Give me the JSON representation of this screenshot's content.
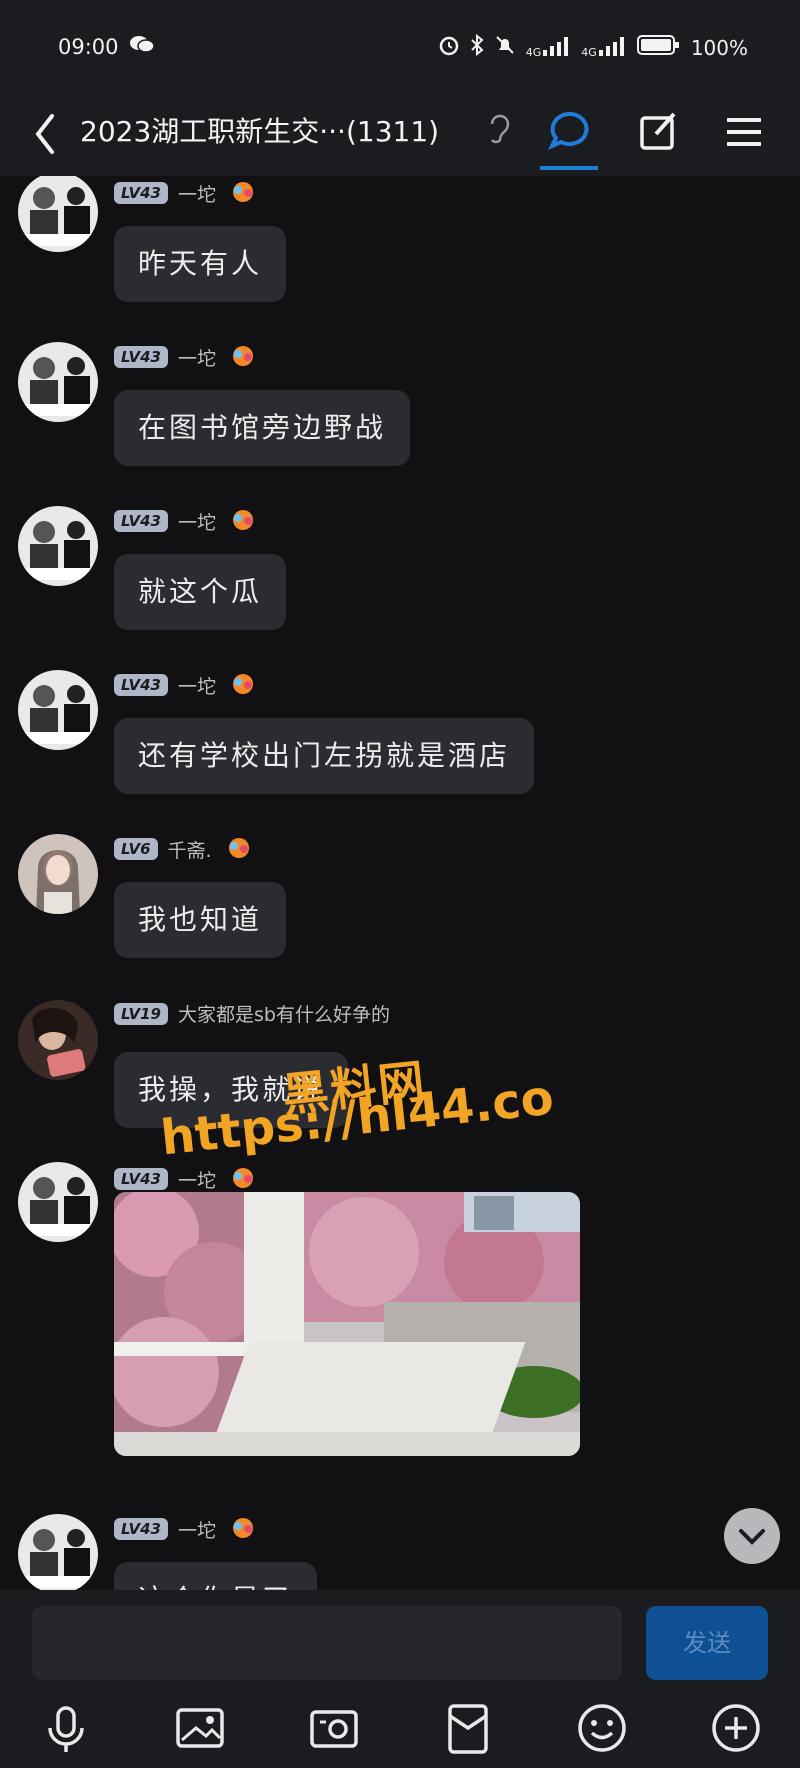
{
  "status": {
    "time": "09:00",
    "battery": "100%",
    "net1": "4G",
    "net2": "4G"
  },
  "header": {
    "title": "2023湖工职新生交···(1311)"
  },
  "messages": [
    {
      "level": "LV43",
      "name": "一坨",
      "text": "昨天有人"
    },
    {
      "level": "LV43",
      "name": "一坨",
      "text": "在图书馆旁边野战"
    },
    {
      "level": "LV43",
      "name": "一坨",
      "text": "就这个瓜"
    },
    {
      "level": "LV43",
      "name": "一坨",
      "text": "还有学校出门左拐就是酒店"
    },
    {
      "level": "LV6",
      "name": "千斋.",
      "text": "我也知道"
    },
    {
      "level": "LV19",
      "name": "大家都是sb有什么好争的",
      "text": "我操，我就说"
    },
    {
      "level": "LV43",
      "name": "一坨",
      "text": ""
    },
    {
      "level": "LV43",
      "name": "一坨",
      "text": "这个你是了"
    }
  ],
  "watermark": {
    "line1": "黑料网",
    "line2": "https://hl44.co"
  },
  "composer": {
    "placeholder": "",
    "send_label": "发送"
  },
  "colors": {
    "accent": "#1f7cd8",
    "bubble": "#2b2c31",
    "background": "#111114",
    "watermark": "#f2a524"
  }
}
